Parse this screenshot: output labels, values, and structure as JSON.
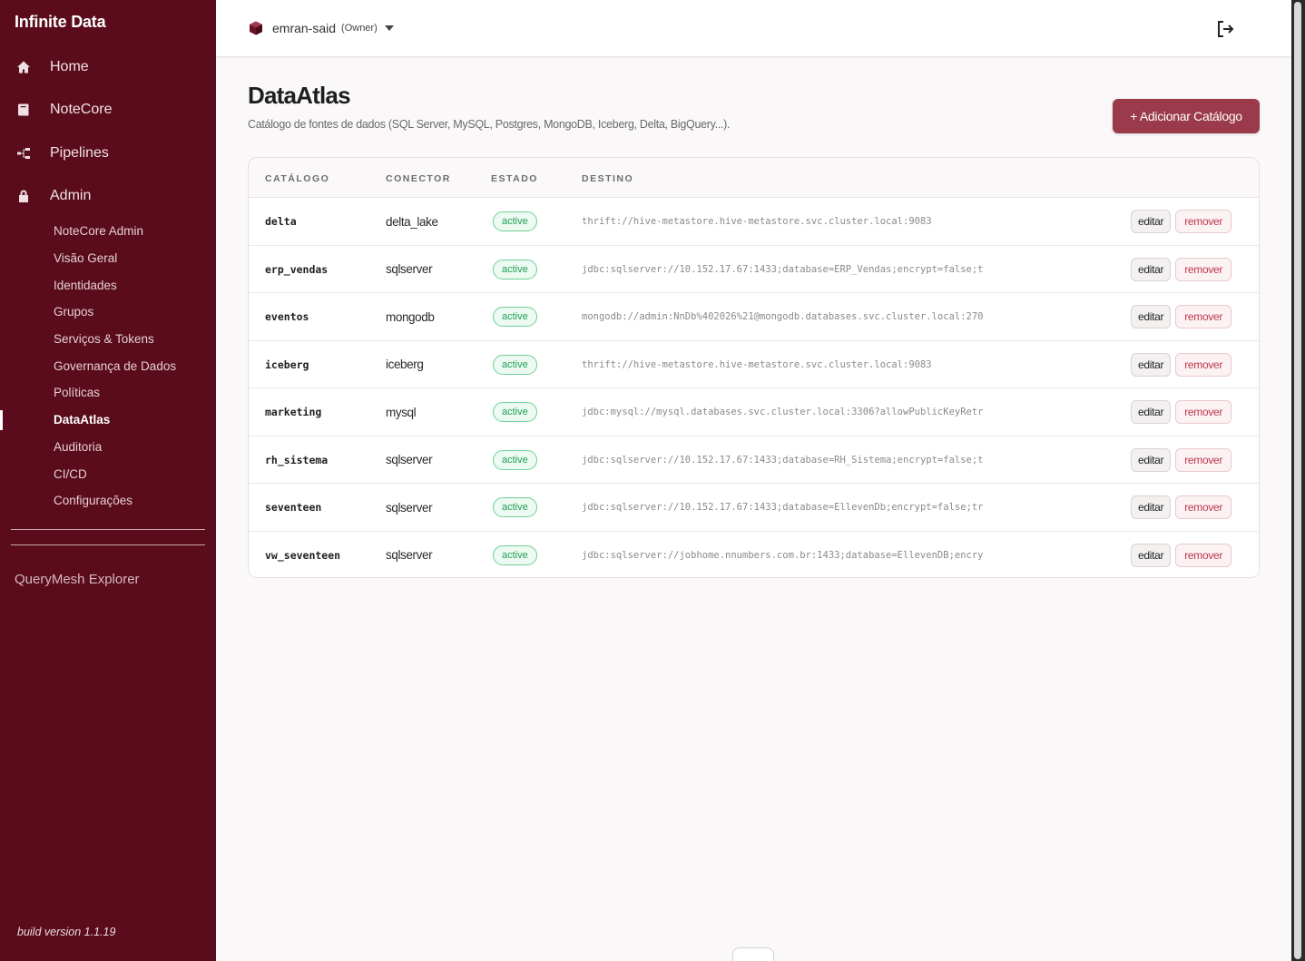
{
  "app": {
    "brand": "Infinite Data",
    "build": "build version 1.1.19"
  },
  "sidebar": {
    "main": [
      {
        "label": "Home",
        "icon": "home-icon"
      },
      {
        "label": "NoteCore",
        "icon": "book-icon"
      },
      {
        "label": "Pipelines",
        "icon": "pipeline-icon"
      },
      {
        "label": "Admin",
        "icon": "lock-icon"
      }
    ],
    "admin_items": [
      "NoteCore Admin",
      "Visão Geral",
      "Identidades",
      "Grupos",
      "Serviços & Tokens",
      "Governança de Dados",
      "Políticas",
      "DataAtlas",
      "Auditoria",
      "CI/CD",
      "Configurações"
    ],
    "active_item": "DataAtlas",
    "querymesh": "QueryMesh Explorer"
  },
  "header": {
    "user": "emran-said",
    "role": "(Owner)"
  },
  "page": {
    "title": "DataAtlas",
    "subtitle": "Catálogo de fontes de dados (SQL Server, MySQL, Postgres, MongoDB, Iceberg, Delta, BigQuery...).",
    "add_button": "+ Adicionar Catálogo"
  },
  "table": {
    "columns": [
      "CATÁLOGO",
      "CONECTOR",
      "ESTADO",
      "DESTINO"
    ],
    "edit_label": "editar",
    "remove_label": "remover",
    "rows": [
      {
        "name": "delta",
        "connector": "delta_lake",
        "state": "active",
        "dest": "thrift://hive-metastore.hive-metastore.svc.cluster.local:9083"
      },
      {
        "name": "erp_vendas",
        "connector": "sqlserver",
        "state": "active",
        "dest": "jdbc:sqlserver://10.152.17.67:1433;database=ERP_Vendas;encrypt=false;t"
      },
      {
        "name": "eventos",
        "connector": "mongodb",
        "state": "active",
        "dest": "mongodb://admin:NnDb%402026%21@mongodb.databases.svc.cluster.local:270"
      },
      {
        "name": "iceberg",
        "connector": "iceberg",
        "state": "active",
        "dest": "thrift://hive-metastore.hive-metastore.svc.cluster.local:9083"
      },
      {
        "name": "marketing",
        "connector": "mysql",
        "state": "active",
        "dest": "jdbc:mysql://mysql.databases.svc.cluster.local:3306?allowPublicKeyRetr"
      },
      {
        "name": "rh_sistema",
        "connector": "sqlserver",
        "state": "active",
        "dest": "jdbc:sqlserver://10.152.17.67:1433;database=RH_Sistema;encrypt=false;t"
      },
      {
        "name": "seventeen",
        "connector": "sqlserver",
        "state": "active",
        "dest": "jdbc:sqlserver://10.152.17.67:1433;database=EllevenDb;encrypt=false;tr"
      },
      {
        "name": "vw_seventeen",
        "connector": "sqlserver",
        "state": "active",
        "dest": "jdbc:sqlserver://jobhome.nnumbers.com.br:1433;database=EllevenDB;encry"
      }
    ]
  },
  "colors": {
    "sidebar": "#5a0c1c",
    "accent": "#9b3a4a",
    "active_badge": "#1f9d58",
    "remove": "#c0364b"
  }
}
